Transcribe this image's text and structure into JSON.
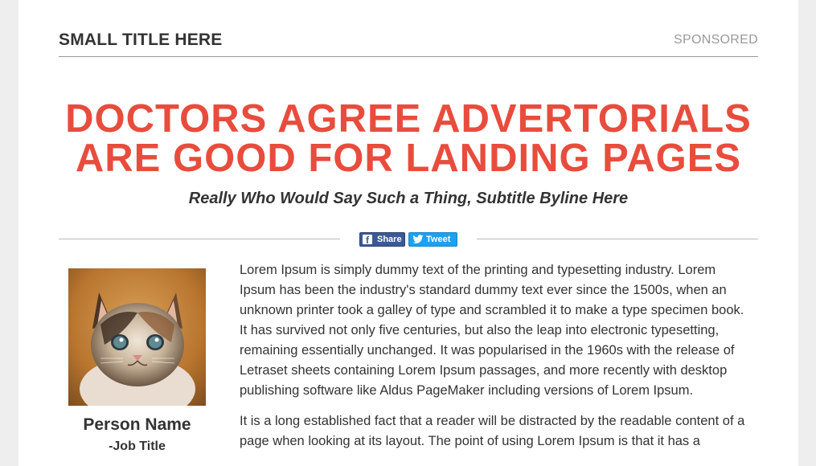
{
  "header": {
    "small_title": "SMALL TITLE HERE",
    "sponsored_label": "SPONSORED"
  },
  "article": {
    "headline_line1": "DOCTORS AGREE ADVERTORIALS",
    "headline_line2": "ARE GOOD FOR LANDING PAGES",
    "subtitle": "Really Who Would Say Such a Thing, Subtitle Byline Here"
  },
  "share": {
    "facebook_label": "Share",
    "twitter_label": "Tweet"
  },
  "author": {
    "name": "Person Name",
    "job_title": "-Job Title",
    "photo_icon": "kitten-photo"
  },
  "body": {
    "paragraph1": "Lorem Ipsum is simply dummy text of the printing and typesetting industry. Lorem Ipsum has been the industry's standard dummy text ever since the 1500s, when an unknown printer took a galley of type and scrambled it to make a type specimen book. It has survived not only five centuries, but also the leap into electronic typesetting, remaining essentially unchanged. It was popularised in the 1960s with the release of Letraset sheets containing Lorem Ipsum passages, and more recently with desktop publishing software like Aldus PageMaker including versions of Lorem Ipsum.",
    "paragraph2": "It is a long established fact that a reader will be distracted by the readable content of a page when looking at its layout. The point of using Lorem Ipsum is that it has a"
  },
  "colors": {
    "headline": "#e84c3d",
    "facebook": "#3b5998",
    "twitter": "#1da1f2",
    "text": "#333333"
  }
}
